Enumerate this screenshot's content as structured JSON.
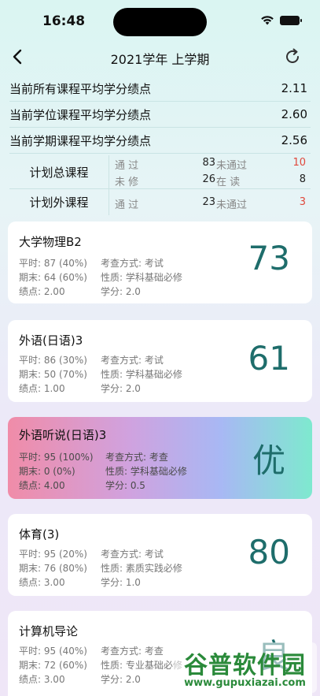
{
  "status_bar": {
    "time": "16:48",
    "icons": [
      "wifi-icon",
      "battery-icon"
    ]
  },
  "nav": {
    "title": "2021学年  上学期",
    "back_icon": "chevron-left-icon",
    "refresh_icon": "refresh-icon"
  },
  "gpa": [
    {
      "label": "当前所有课程平均学分绩点",
      "value": "2.11"
    },
    {
      "label": "当前学位课程平均学分绩点",
      "value": "2.60"
    },
    {
      "label": "当前学期课程平均学分绩点",
      "value": "2.56"
    }
  ],
  "stats": {
    "planned": {
      "label": "计划总课程",
      "passed_label": "通    过",
      "passed": "83",
      "failed_label": "未通过",
      "failed": "10",
      "unstudied_label": "未    修",
      "unstudied": "26",
      "studying_label": "在    读",
      "studying": "8"
    },
    "extra": {
      "label": "计划外课程",
      "passed_label": "通    过",
      "passed": "23",
      "failed_label": "未通过",
      "failed": "3"
    }
  },
  "colors": {
    "score": "#1e6d6b",
    "fail": "#e0483c",
    "accent_gradient": [
      "#f08ca8",
      "#7ee9cf"
    ]
  },
  "courses": [
    {
      "name": "大学物理B2",
      "regular": "平时: 87 (40%)",
      "final": "期末: 64 (60%)",
      "gp": "绩点: 2.00",
      "exam": "考查方式: 考试",
      "nature": "性质: 学科基础必修",
      "credit": "学分: 2.0",
      "score": "73"
    },
    {
      "name": "外语(日语)3",
      "regular": "平时: 86 (30%)",
      "final": "期末: 50 (70%)",
      "gp": "绩点: 1.00",
      "exam": "考查方式: 考试",
      "nature": "性质: 学科基础必修",
      "credit": "学分: 2.0",
      "score": "61"
    },
    {
      "name": "外语听说(日语)3",
      "regular": "平时: 95 (100%)",
      "final": "期末: 0 (0%)",
      "gp": "绩点: 4.00",
      "exam": "考查方式: 考查",
      "nature": "性质: 学科基础必修",
      "credit": "学分: 0.5",
      "score": "优"
    },
    {
      "name": "体育(3)",
      "regular": "平时: 95 (20%)",
      "final": "期末: 76 (80%)",
      "gp": "绩点: 3.00",
      "exam": "考查方式: 考试",
      "nature": "性质: 素质实践必修",
      "credit": "学分: 1.0",
      "score": "80"
    },
    {
      "name": "计算机导论",
      "regular": "平时: 95 (40%)",
      "final": "期末: 72 (60%)",
      "gp": "绩点: 3.00",
      "exam": "考查方式: 考查",
      "nature": "性质: 专业基础必修",
      "credit": "学分: 2.0",
      "score": "良"
    }
  ],
  "watermark": {
    "title": "谷普软件园",
    "subtitle": "www.gupuxiazai.com"
  }
}
